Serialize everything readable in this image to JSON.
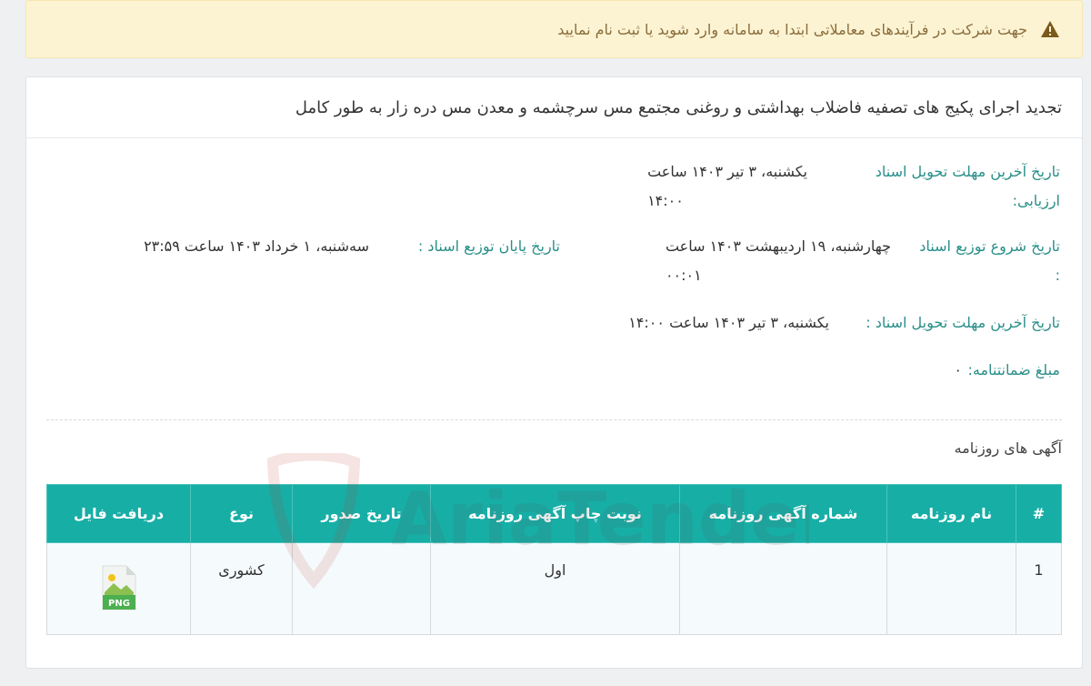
{
  "alert": {
    "icon": "warning-icon",
    "text": "جهت شرکت در فرآیندهای معاملاتی ابتدا به سامانه وارد شوید یا ثبت نام نمایید",
    "color": "#8a6d3b"
  },
  "tender": {
    "title": "تجدید اجرای پکیج های تصفیه فاضلاب بهداشتی و روغنی مجتمع مس سرچشمه و معدن مس دره زار به طور کامل"
  },
  "fields": {
    "eval_deadline_label_1": "تاریخ آخرین مهلت تحویل اسناد",
    "eval_deadline_label_2": "ارزیابی:",
    "eval_deadline_value_1": "یکشنبه، ۳ تیر ۱۴۰۳ ساعت",
    "eval_deadline_value_2": "۱۴:۰۰",
    "dist_start_label_1": "تاریخ شروع توزیع اسناد",
    "dist_start_label_2": ":",
    "dist_start_value_1": "چهارشنبه، ۱۹ اردیبهشت ۱۴۰۳ ساعت",
    "dist_start_value_2": "۰۰:۰۱",
    "dist_end_label": "تاریخ پایان توزیع اسناد :",
    "dist_end_value": "سه‌شنبه، ۱ خرداد ۱۴۰۳ ساعت ۲۳:۵۹",
    "doc_deadline_label": "تاریخ آخرین مهلت تحویل اسناد :",
    "doc_deadline_value": "یکشنبه، ۳ تیر ۱۴۰۳ ساعت ۱۴:۰۰",
    "guarantee_label": "مبلغ ضمانتنامه:",
    "guarantee_value": "۰"
  },
  "ads": {
    "section_title": "آگهی های روزنامه",
    "headers": [
      "#",
      "نام روزنامه",
      "شماره آگهی روزنامه",
      "نوبت چاپ آگهی روزنامه",
      "تاریخ صدور",
      "نوع",
      "دریافت فایل"
    ],
    "rows": [
      {
        "index": "1",
        "newspaper": "",
        "ad_number": "",
        "print_round": "اول",
        "issue_date": "",
        "type": "کشوری",
        "file_icon": "png-file-icon",
        "file_label": "PNG"
      }
    ]
  },
  "watermark": {
    "text": "AriaTender.neT"
  },
  "colors": {
    "accent": "#17aea6",
    "label": "#2a8f8a",
    "alert_bg": "#fcf3d3"
  }
}
